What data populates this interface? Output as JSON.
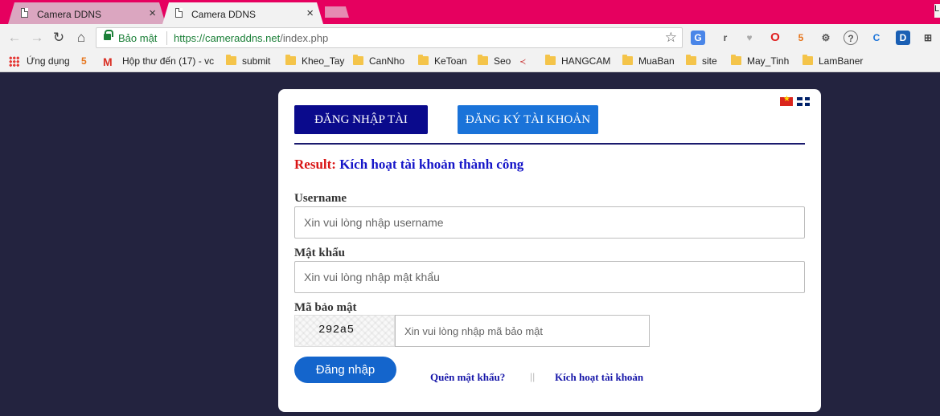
{
  "browser": {
    "tabs": [
      {
        "title": "Camera DDNS",
        "close": "×"
      },
      {
        "title": "Camera DDNS",
        "close": "×"
      }
    ],
    "corner_text": "L",
    "security_label": "Bảo mật",
    "url_scheme_host": "https://cameraddns.net",
    "url_path": "/index.php",
    "extensions": [
      "G",
      "r",
      "♥",
      "O",
      "5",
      "⚙",
      "?",
      "C",
      "D",
      "⊞"
    ]
  },
  "bookmarks": [
    {
      "label": "Ứng dụng",
      "icon": "apps-grid-icon"
    },
    {
      "label": "",
      "icon": "bookmark-logo-icon"
    },
    {
      "label": "Hộp thư đến (17) - vc",
      "icon": "gmail-icon"
    },
    {
      "label": "submit",
      "icon": "folder-icon"
    },
    {
      "label": "Kheo_Tay",
      "icon": "folder-icon"
    },
    {
      "label": "CanNho",
      "icon": "folder-icon"
    },
    {
      "label": "KeToan",
      "icon": "folder-icon"
    },
    {
      "label": "Seo",
      "icon": "folder-icon"
    },
    {
      "label": "",
      "icon": "site-logo-icon"
    },
    {
      "label": "HANGCAM",
      "icon": "folder-icon"
    },
    {
      "label": "MuaBan",
      "icon": "folder-icon"
    },
    {
      "label": "site",
      "icon": "folder-icon"
    },
    {
      "label": "May_Tinh",
      "icon": "folder-icon"
    },
    {
      "label": "LamBaner",
      "icon": "folder-icon"
    }
  ],
  "card": {
    "tab_login": "ĐĂNG NHẬP TÀI KHOẢN",
    "tab_register": "ĐĂNG KÝ TÀI KHOẢN",
    "result_label": "Result:",
    "result_message": "Kích hoạt tài khoản thành công",
    "username_label": "Username",
    "username_placeholder": "Xin vui lòng nhập username",
    "password_label": "Mật khẩu",
    "password_placeholder": "Xin vui lòng nhập mật khẩu",
    "captcha_label": "Mã bảo mật",
    "captcha_code": "292a5",
    "captcha_placeholder": "Xin vui lòng nhập mã bảo mật",
    "submit_label": "Đăng nhập",
    "forgot_link": "Quên mật khẩu?",
    "separator": "||",
    "activate_link": "Kích hoạt tài khoản"
  },
  "colors": {
    "page_background": "#23233f",
    "tabstrip": "#e6005f",
    "login_tab": "#0a0a8c",
    "register_tab": "#1a73d9",
    "result_label": "#d91515",
    "result_message": "#1515c8",
    "submit_button": "#1465cc"
  }
}
